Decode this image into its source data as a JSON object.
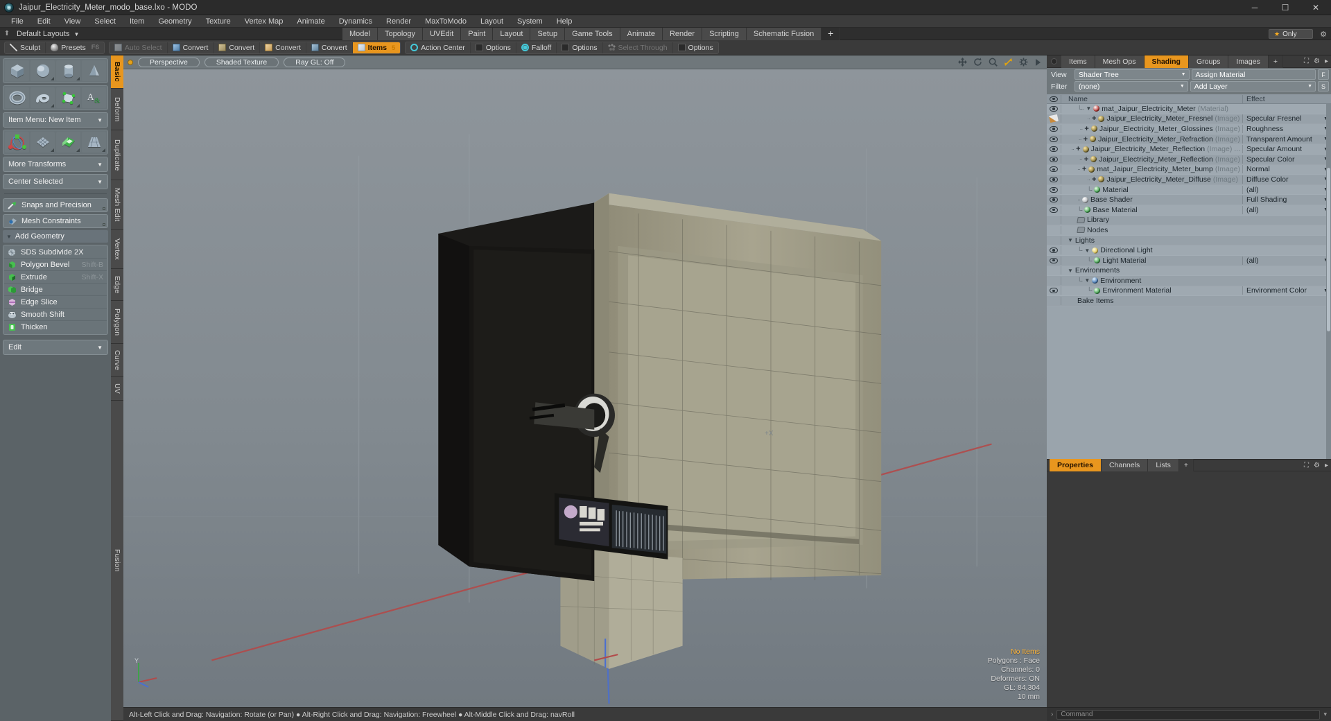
{
  "titlebar": {
    "title": "Jaipur_Electricity_Meter_modo_base.lxo - MODO",
    "app_icon": "modo-logo-icon",
    "minimize": "─",
    "maximize": "☐",
    "close": "✕"
  },
  "menu": [
    "File",
    "Edit",
    "View",
    "Select",
    "Item",
    "Geometry",
    "Texture",
    "Vertex Map",
    "Animate",
    "Dynamics",
    "Render",
    "MaxToModo",
    "Layout",
    "System",
    "Help"
  ],
  "layoutbar": {
    "pin_icon": "pin-icon",
    "default_layouts": "Default Layouts",
    "tabs": [
      "Model",
      "Topology",
      "UVEdit",
      "Paint",
      "Layout",
      "Setup",
      "Game Tools",
      "Animate",
      "Render",
      "Scripting",
      "Schematic Fusion"
    ],
    "add_tab": "+",
    "only_label": "Only",
    "star_icon": "star-icon",
    "gear_icon": "gear-icon"
  },
  "toolbar": {
    "group1": [
      {
        "label": "Sculpt",
        "icon": "sculpt-icon",
        "state": "normal"
      },
      {
        "label": "Presets",
        "icon": "presets-icon",
        "state": "normal",
        "shortcut": "F6"
      }
    ],
    "group2": [
      {
        "label": "Auto Select",
        "icon": "cube-grey-icon",
        "state": "disabled"
      },
      {
        "label": "Convert",
        "icon": "cube-blue-icon",
        "state": "normal"
      },
      {
        "label": "Convert",
        "icon": "cube-green-icon",
        "state": "normal"
      },
      {
        "label": "Convert",
        "icon": "cube-tan-icon",
        "state": "normal"
      },
      {
        "label": "Convert",
        "icon": "cube-steel-icon",
        "state": "normal"
      },
      {
        "label": "Items",
        "icon": "cube-white-icon",
        "state": "active",
        "badge": "5"
      }
    ],
    "group3": [
      {
        "label": "Action Center",
        "icon": "action-center-icon",
        "state": "normal"
      },
      {
        "label": "Options",
        "icon": "options-icon",
        "state": "normal"
      },
      {
        "label": "Falloff",
        "icon": "falloff-icon",
        "state": "normal"
      },
      {
        "label": "Options",
        "icon": "options-icon",
        "state": "normal"
      },
      {
        "label": "Select Through",
        "icon": "select-through-icon",
        "state": "disabled"
      },
      {
        "label": "Options",
        "icon": "options-icon",
        "state": "normal"
      }
    ]
  },
  "left_panel": {
    "primitives_row1": [
      "cube-primitive",
      "sphere-primitive",
      "cylinder-primitive",
      "cone-primitive"
    ],
    "primitives_row2": [
      "torus-primitive",
      "spiral-primitive",
      "facet-primitive",
      "text-primitive"
    ],
    "item_menu": "Item Menu: New Item",
    "transform_row": [
      "transform-gizmo",
      "grid-mesh",
      "checker-mesh",
      "taper-mesh"
    ],
    "more_transforms": "More Transforms",
    "center_selected": "Center Selected",
    "snaps": "Snaps and Precision",
    "mesh_constraints": "Mesh Constraints",
    "add_geometry": "Add Geometry",
    "geometry_items": [
      {
        "label": "SDS Subdivide 2X",
        "shortcut": "",
        "icon": "sds-icon"
      },
      {
        "label": "Polygon Bevel",
        "shortcut": "Shift-B",
        "icon": "bevel-icon"
      },
      {
        "label": "Extrude",
        "shortcut": "Shift-X",
        "icon": "extrude-icon"
      },
      {
        "label": "Bridge",
        "shortcut": "",
        "icon": "bridge-icon"
      },
      {
        "label": "Edge Slice",
        "shortcut": "",
        "icon": "edge-slice-icon"
      },
      {
        "label": "Smooth Shift",
        "shortcut": "",
        "icon": "smooth-shift-icon"
      },
      {
        "label": "Thicken",
        "shortcut": "",
        "icon": "thicken-icon"
      }
    ],
    "edit": "Edit",
    "vtabs": [
      "Basic",
      "Deform",
      "Duplicate",
      "Mesh Edit",
      "Vertex",
      "Edge",
      "Polygon",
      "Curve",
      "UV",
      "Fusion"
    ],
    "vtab_active": "Basic"
  },
  "viewport": {
    "header_pills": [
      "Perspective",
      "Shaded Texture",
      "Ray GL: Off"
    ],
    "header_icons": [
      "move-icon",
      "rotate-icon",
      "zoom-icon",
      "fit-icon",
      "gear-icon",
      "play-icon"
    ],
    "status": {
      "no_items": "No Items",
      "polygons": "Polygons : Face",
      "channels": "Channels: 0",
      "deformers": "Deformers: ON",
      "gl": "GL: 84,304",
      "scale": "10 mm"
    },
    "axis_label": "Y",
    "plus_x_marker": "+X",
    "statusbar": "Alt-Left Click and Drag: Navigation: Rotate (or Pan) ● Alt-Right Click and Drag: Navigation: Freewheel ● Alt-Middle Click and Drag: navRoll"
  },
  "right_panel": {
    "tabs": [
      "Items",
      "Mesh Ops",
      "Shading",
      "Groups",
      "Images"
    ],
    "tab_active": "Shading",
    "add_tab": "+",
    "view_label": "View",
    "view_value": "Shader Tree",
    "assign_material": "Assign Material",
    "assign_btn": "F",
    "filter_label": "Filter",
    "filter_value": "(none)",
    "add_layer": "Add Layer",
    "add_layer_btn": "S",
    "columns": {
      "name": "Name",
      "effect": "Effect"
    },
    "rows": [
      {
        "eye": "eye",
        "indent": 1,
        "twig": "└··",
        "tri": true,
        "sphere": "mat",
        "name": "mat_Jaipur_Electricity_Meter",
        "suffix": "(Material)",
        "effect": "",
        "caret": true
      },
      {
        "eye": "brush",
        "indent": 2,
        "twig": "··",
        "plus": true,
        "sphere": "img",
        "name": "Jaipur_Electricity_Meter_Fresnel",
        "suffix": "(Image)",
        "effect": "Specular Fresnel",
        "caret": true
      },
      {
        "eye": "eye",
        "indent": 2,
        "twig": "··",
        "plus": true,
        "sphere": "img",
        "name": "Jaipur_Electricity_Meter_Glossines",
        "suffix": "(Image)",
        "effect": "Roughness",
        "caret": true
      },
      {
        "eye": "eye",
        "indent": 2,
        "twig": "··",
        "plus": true,
        "sphere": "img",
        "name": "Jaipur_Electricity_Meter_Refraction",
        "suffix": "(Image)",
        "effect": "Transparent Amount",
        "caret": true
      },
      {
        "eye": "eye",
        "indent": 2,
        "twig": "··",
        "plus": true,
        "sphere": "img",
        "name": "Jaipur_Electricity_Meter_Reflection",
        "suffix": "(Image) ...",
        "effect": "Specular Amount",
        "caret": true
      },
      {
        "eye": "eye",
        "indent": 2,
        "twig": "··",
        "plus": true,
        "sphere": "img",
        "name": "Jaipur_Electricity_Meter_Reflection",
        "suffix": "(Image)",
        "effect": "Specular Color",
        "caret": true
      },
      {
        "eye": "eye",
        "indent": 2,
        "twig": "··",
        "plus": true,
        "sphere": "img",
        "name": "mat_Jaipur_Electricity_Meter_bump",
        "suffix": "(Image)",
        "effect": "Normal",
        "caret": true
      },
      {
        "eye": "eye",
        "indent": 2,
        "twig": "··",
        "plus": true,
        "sphere": "img",
        "name": "Jaipur_Electricity_Meter_Diffuse",
        "suffix": "(Image)",
        "effect": "Diffuse Color",
        "caret": true
      },
      {
        "eye": "eye",
        "indent": 2,
        "twig": "└·",
        "sphere": "green",
        "name": "Material",
        "suffix": "",
        "effect": "(all)",
        "caret": true
      },
      {
        "eye": "eye",
        "indent": 1,
        "twig": "··",
        "sphere": "grey",
        "name": "Base Shader",
        "suffix": "",
        "effect": "Full Shading",
        "caret": true
      },
      {
        "eye": "eye",
        "indent": 1,
        "twig": "└·",
        "sphere": "green",
        "name": "Base Material",
        "suffix": "",
        "effect": "(all)",
        "caret": true
      },
      {
        "eye": "",
        "indent": 1,
        "folder": true,
        "name": "Library",
        "suffix": "",
        "effect": "",
        "caret": false
      },
      {
        "eye": "",
        "indent": 1,
        "folder": true,
        "name": "Nodes",
        "suffix": "",
        "effect": "",
        "caret": false
      },
      {
        "eye": "",
        "indent": 0,
        "tri": true,
        "name": "Lights",
        "suffix": "",
        "effect": "",
        "caret": false
      },
      {
        "eye": "eye",
        "indent": 1,
        "twig": "└·",
        "tri": true,
        "sphere": "light",
        "name": "Directional Light",
        "suffix": "",
        "effect": "",
        "caret": false
      },
      {
        "eye": "eye",
        "indent": 2,
        "twig": "└·",
        "sphere": "green",
        "name": "Light Material",
        "suffix": "",
        "effect": "(all)",
        "caret": true
      },
      {
        "eye": "",
        "indent": 0,
        "tri": true,
        "name": "Environments",
        "suffix": "",
        "effect": "",
        "caret": false
      },
      {
        "eye": "",
        "indent": 1,
        "twig": "└·",
        "tri": true,
        "sphere": "env",
        "name": "Environment",
        "suffix": "",
        "effect": "",
        "caret": false
      },
      {
        "eye": "eye",
        "indent": 2,
        "twig": "└·",
        "sphere": "green",
        "name": "Environment Material",
        "suffix": "",
        "effect": "Environment Color",
        "caret": true
      },
      {
        "eye": "",
        "indent": 1,
        "name": "Bake Items",
        "suffix": "",
        "effect": "",
        "caret": false
      }
    ],
    "props_tabs": [
      "Properties",
      "Channels",
      "Lists"
    ],
    "props_tab_active": "Properties",
    "props_add": "+",
    "command_placeholder": "Command",
    "command_arrow": "›"
  },
  "colors": {
    "accent": "#e8961e",
    "panel_bg": "#3a3a3a",
    "tree_bg": "#9aa4ac",
    "left_panel": "#5b6367",
    "viewport_top": "#8b9298",
    "status_highlight": "#ffb437"
  }
}
